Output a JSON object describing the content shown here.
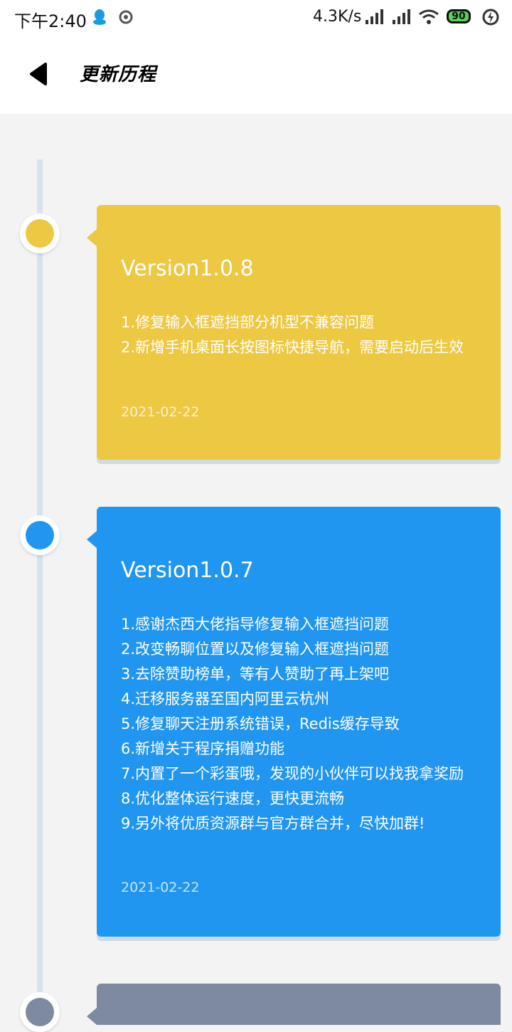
{
  "status_bar": {
    "time": "下午2:40",
    "speed": "4.3K/s",
    "battery": "90"
  },
  "header": {
    "title": "更新历程"
  },
  "entries": [
    {
      "version": "Version1.0.8",
      "notes": [
        "1.修复输入框遮挡部分机型不兼容问题",
        "2.新增手机桌面长按图标快捷导航，需要启动后生效"
      ],
      "date": "2021-02-22",
      "color": "#edc843"
    },
    {
      "version": "Version1.0.7",
      "notes": [
        "1.感谢杰西大佬指导修复输入框遮挡问题",
        "2.改变畅聊位置以及修复输入框遮挡问题",
        "3.去除赞助榜单，等有人赞助了再上架吧",
        "4.迁移服务器至国内阿里云杭州",
        "5.修复聊天注册系统错误，Redis缓存导致",
        "6.新增关于程序捐赠功能",
        "7.内置了一个彩蛋哦，发现的小伙伴可以找我拿奖励",
        "8.优化整体运行速度，更快更流畅",
        "9.另外将优质资源群与官方群合并，尽快加群!"
      ],
      "date": "2021-02-22",
      "color": "#2196f0"
    },
    {
      "color": "#7e8aa0"
    }
  ]
}
